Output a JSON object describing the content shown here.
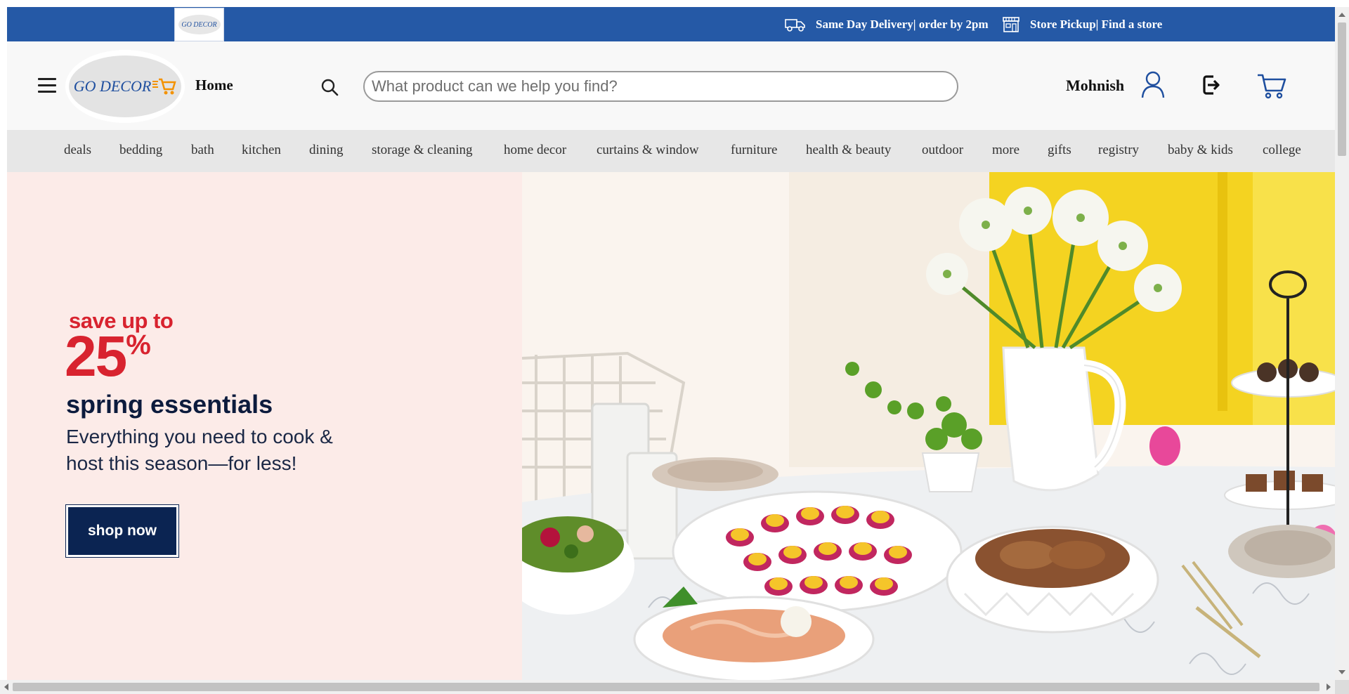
{
  "promo_bar": {
    "logo_text": "GO DECOR",
    "delivery_text": "Same Day Delivery| order by 2pm",
    "pickup_text": "Store Pickup| Find a store",
    "background": "#2559a6"
  },
  "header": {
    "logo_text": "GO DECOR",
    "home_label": "Home",
    "search_placeholder": "What product can we help you find?",
    "search_value": "",
    "user_name": "Mohnish",
    "icons": [
      "menu-icon",
      "search-icon",
      "user-icon",
      "logout-icon",
      "cart-icon"
    ]
  },
  "categories": [
    "deals",
    "bedding",
    "bath",
    "kitchen",
    "dining",
    "storage & cleaning",
    "home decor",
    "curtains & window",
    "furniture",
    "health & beauty",
    "outdoor",
    "more",
    "gifts",
    "registry",
    "baby & kids",
    "college"
  ],
  "hero": {
    "eyebrow": "save up to",
    "amount": "25",
    "percent": "%",
    "title": "spring essentials",
    "subtitle": "Everything you need to cook & host this season—for less!",
    "cta": "shop now",
    "colors": {
      "accent_red": "#d8232f",
      "navy": "#0b2452",
      "background": "#fcebe8"
    }
  }
}
